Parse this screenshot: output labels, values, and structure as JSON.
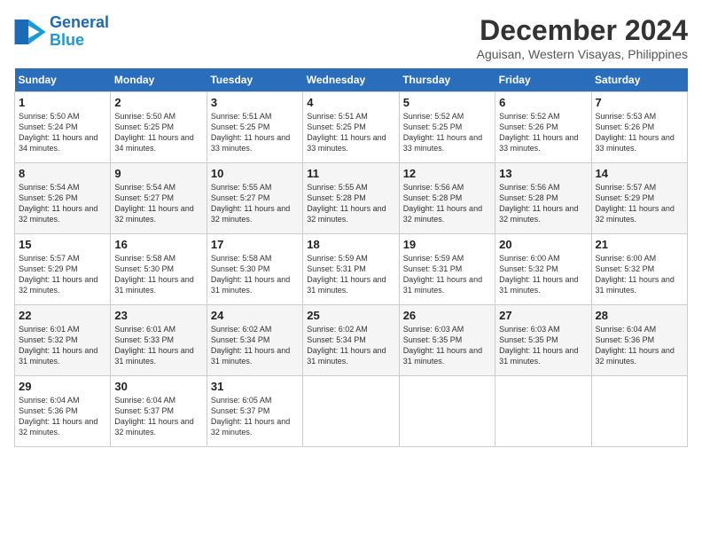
{
  "header": {
    "logo_line1": "General",
    "logo_line2": "Blue",
    "month": "December 2024",
    "location": "Aguisan, Western Visayas, Philippines"
  },
  "weekdays": [
    "Sunday",
    "Monday",
    "Tuesday",
    "Wednesday",
    "Thursday",
    "Friday",
    "Saturday"
  ],
  "weeks": [
    [
      {
        "day": 1,
        "sunrise": "5:50 AM",
        "sunset": "5:24 PM",
        "daylight": "11 hours and 34 minutes."
      },
      {
        "day": 2,
        "sunrise": "5:50 AM",
        "sunset": "5:25 PM",
        "daylight": "11 hours and 34 minutes."
      },
      {
        "day": 3,
        "sunrise": "5:51 AM",
        "sunset": "5:25 PM",
        "daylight": "11 hours and 33 minutes."
      },
      {
        "day": 4,
        "sunrise": "5:51 AM",
        "sunset": "5:25 PM",
        "daylight": "11 hours and 33 minutes."
      },
      {
        "day": 5,
        "sunrise": "5:52 AM",
        "sunset": "5:25 PM",
        "daylight": "11 hours and 33 minutes."
      },
      {
        "day": 6,
        "sunrise": "5:52 AM",
        "sunset": "5:26 PM",
        "daylight": "11 hours and 33 minutes."
      },
      {
        "day": 7,
        "sunrise": "5:53 AM",
        "sunset": "5:26 PM",
        "daylight": "11 hours and 33 minutes."
      }
    ],
    [
      {
        "day": 8,
        "sunrise": "5:54 AM",
        "sunset": "5:26 PM",
        "daylight": "11 hours and 32 minutes."
      },
      {
        "day": 9,
        "sunrise": "5:54 AM",
        "sunset": "5:27 PM",
        "daylight": "11 hours and 32 minutes."
      },
      {
        "day": 10,
        "sunrise": "5:55 AM",
        "sunset": "5:27 PM",
        "daylight": "11 hours and 32 minutes."
      },
      {
        "day": 11,
        "sunrise": "5:55 AM",
        "sunset": "5:28 PM",
        "daylight": "11 hours and 32 minutes."
      },
      {
        "day": 12,
        "sunrise": "5:56 AM",
        "sunset": "5:28 PM",
        "daylight": "11 hours and 32 minutes."
      },
      {
        "day": 13,
        "sunrise": "5:56 AM",
        "sunset": "5:28 PM",
        "daylight": "11 hours and 32 minutes."
      },
      {
        "day": 14,
        "sunrise": "5:57 AM",
        "sunset": "5:29 PM",
        "daylight": "11 hours and 32 minutes."
      }
    ],
    [
      {
        "day": 15,
        "sunrise": "5:57 AM",
        "sunset": "5:29 PM",
        "daylight": "11 hours and 32 minutes."
      },
      {
        "day": 16,
        "sunrise": "5:58 AM",
        "sunset": "5:30 PM",
        "daylight": "11 hours and 31 minutes."
      },
      {
        "day": 17,
        "sunrise": "5:58 AM",
        "sunset": "5:30 PM",
        "daylight": "11 hours and 31 minutes."
      },
      {
        "day": 18,
        "sunrise": "5:59 AM",
        "sunset": "5:31 PM",
        "daylight": "11 hours and 31 minutes."
      },
      {
        "day": 19,
        "sunrise": "5:59 AM",
        "sunset": "5:31 PM",
        "daylight": "11 hours and 31 minutes."
      },
      {
        "day": 20,
        "sunrise": "6:00 AM",
        "sunset": "5:32 PM",
        "daylight": "11 hours and 31 minutes."
      },
      {
        "day": 21,
        "sunrise": "6:00 AM",
        "sunset": "5:32 PM",
        "daylight": "11 hours and 31 minutes."
      }
    ],
    [
      {
        "day": 22,
        "sunrise": "6:01 AM",
        "sunset": "5:32 PM",
        "daylight": "11 hours and 31 minutes."
      },
      {
        "day": 23,
        "sunrise": "6:01 AM",
        "sunset": "5:33 PM",
        "daylight": "11 hours and 31 minutes."
      },
      {
        "day": 24,
        "sunrise": "6:02 AM",
        "sunset": "5:34 PM",
        "daylight": "11 hours and 31 minutes."
      },
      {
        "day": 25,
        "sunrise": "6:02 AM",
        "sunset": "5:34 PM",
        "daylight": "11 hours and 31 minutes."
      },
      {
        "day": 26,
        "sunrise": "6:03 AM",
        "sunset": "5:35 PM",
        "daylight": "11 hours and 31 minutes."
      },
      {
        "day": 27,
        "sunrise": "6:03 AM",
        "sunset": "5:35 PM",
        "daylight": "11 hours and 31 minutes."
      },
      {
        "day": 28,
        "sunrise": "6:04 AM",
        "sunset": "5:36 PM",
        "daylight": "11 hours and 32 minutes."
      }
    ],
    [
      {
        "day": 29,
        "sunrise": "6:04 AM",
        "sunset": "5:36 PM",
        "daylight": "11 hours and 32 minutes."
      },
      {
        "day": 30,
        "sunrise": "6:04 AM",
        "sunset": "5:37 PM",
        "daylight": "11 hours and 32 minutes."
      },
      {
        "day": 31,
        "sunrise": "6:05 AM",
        "sunset": "5:37 PM",
        "daylight": "11 hours and 32 minutes."
      },
      null,
      null,
      null,
      null
    ]
  ]
}
